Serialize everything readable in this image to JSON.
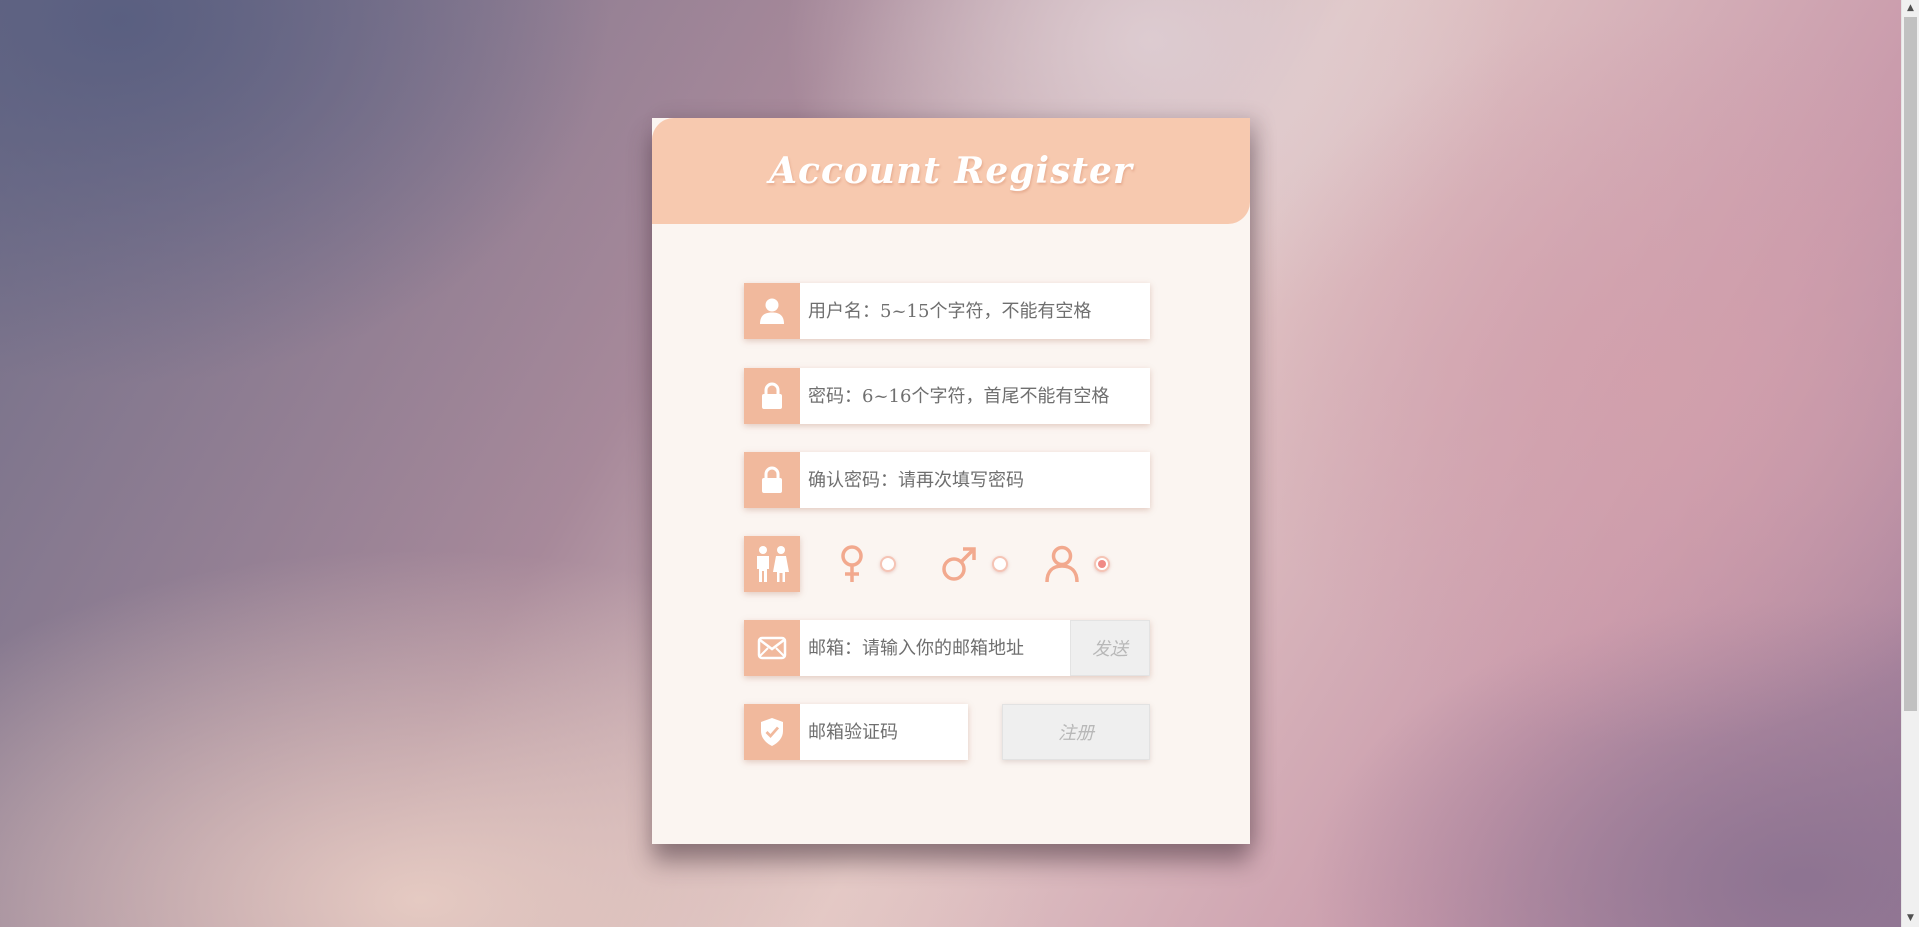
{
  "form": {
    "title": "Account Register",
    "username": {
      "placeholder": "用户名：5~15个字符，不能有空格",
      "icon": "user-icon"
    },
    "password": {
      "placeholder": "密码：6~16个字符，首尾不能有空格",
      "icon": "lock-icon"
    },
    "confirm_password": {
      "placeholder": "确认密码：请再次填写密码",
      "icon": "lock-icon"
    },
    "gender": {
      "icon": "couple-icon",
      "options": [
        {
          "name": "female",
          "icon": "female-symbol-icon",
          "checked": false
        },
        {
          "name": "male",
          "icon": "male-symbol-icon",
          "checked": false
        },
        {
          "name": "unspecified",
          "icon": "person-outline-icon",
          "checked": true
        }
      ]
    },
    "email": {
      "placeholder": "邮箱：请输入你的邮箱地址",
      "icon": "envelope-icon",
      "send_label": "发送"
    },
    "code": {
      "placeholder": "邮箱验证码",
      "icon": "shield-check-icon"
    },
    "register_label": "注册"
  },
  "colors": {
    "header": "#f7c9af",
    "icon_box": "#f1b99d",
    "card": "#fbf5f1",
    "radio_checked": "#f08a86",
    "gender_symbol": "#f2a98e"
  }
}
